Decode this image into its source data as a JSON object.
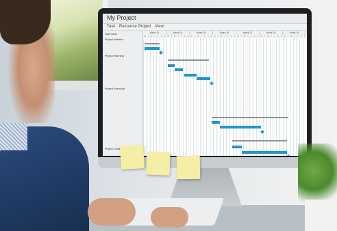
{
  "app": {
    "title": "My Project",
    "menu": [
      "Task",
      "Resource",
      "Project",
      "View"
    ]
  },
  "tasks": [
    {
      "label": "Task name",
      "sub": false
    },
    {
      "label": "Project Initiation",
      "sub": false
    },
    {
      "label": "",
      "sub": true
    },
    {
      "label": "",
      "sub": true
    },
    {
      "label": "Project Planning",
      "sub": false
    },
    {
      "label": "",
      "sub": true
    },
    {
      "label": "",
      "sub": true
    },
    {
      "label": "",
      "sub": true
    },
    {
      "label": "",
      "sub": true
    },
    {
      "label": "",
      "sub": true
    },
    {
      "label": "Project Execution",
      "sub": false
    },
    {
      "label": "",
      "sub": true
    },
    {
      "label": "",
      "sub": true
    },
    {
      "label": "",
      "sub": true
    },
    {
      "label": "",
      "sub": true
    },
    {
      "label": "",
      "sub": true
    },
    {
      "label": "",
      "sub": true
    },
    {
      "label": "",
      "sub": true
    },
    {
      "label": "",
      "sub": true
    },
    {
      "label": "",
      "sub": true
    },
    {
      "label": "",
      "sub": true
    },
    {
      "label": "Project Closing",
      "sub": false
    }
  ],
  "weeks": [
    "Week 23",
    "Week 24",
    "Week 25",
    "Week 26",
    "Week 27",
    "Week 28",
    "Week 29"
  ],
  "days": [
    "M",
    "T",
    "W",
    "T",
    "F",
    "S",
    "S"
  ],
  "colors": {
    "bar": "#1f95d3",
    "summary": "#8d9296"
  }
}
